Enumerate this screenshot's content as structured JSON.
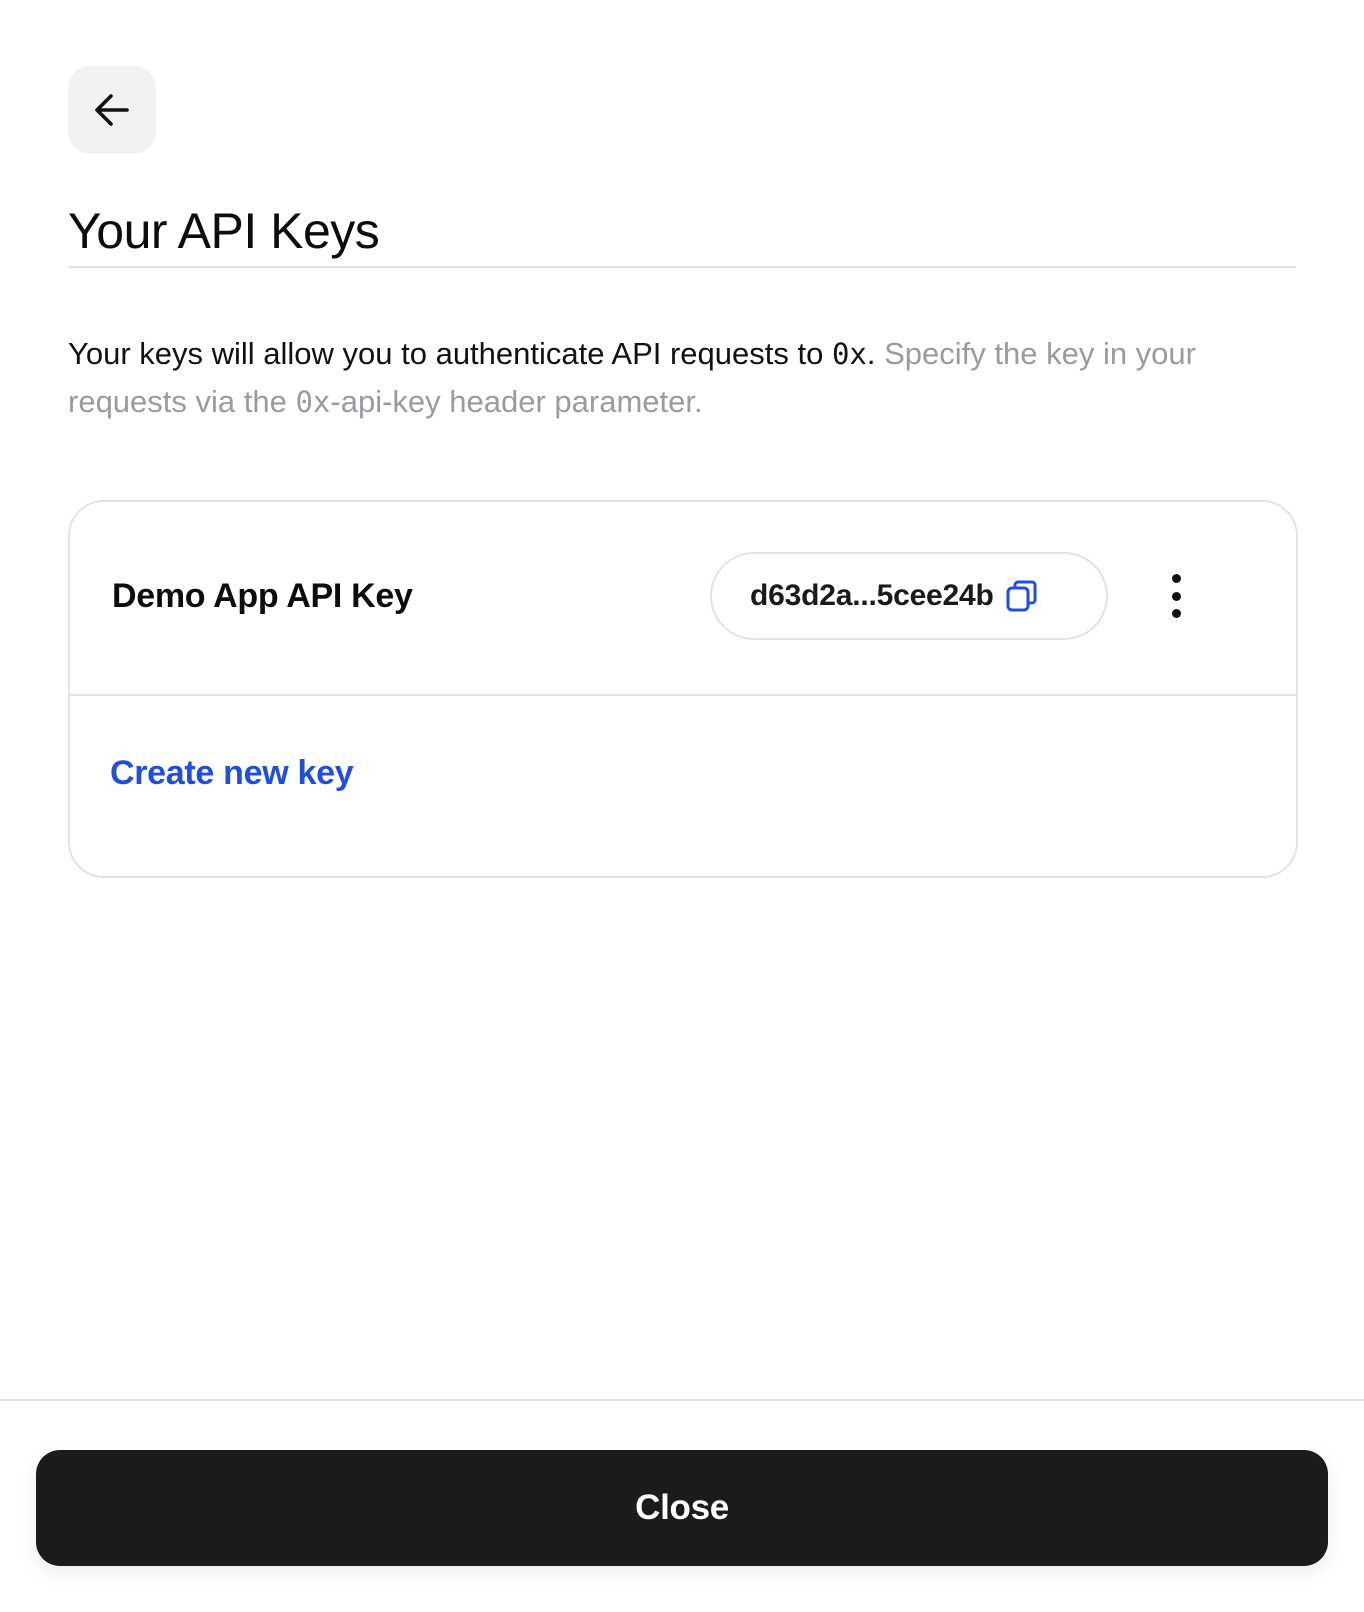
{
  "header": {
    "back_icon": "arrow-left-icon",
    "title": "Your API Keys"
  },
  "description": {
    "lead": "Your keys will allow you to authenticate API requests to ",
    "lead_code": "0x",
    "lead_end": ".",
    "muted_start": " Specify the key in your requests via the ",
    "muted_code": "0x",
    "muted_end": "-api-key header parameter."
  },
  "keys": [
    {
      "name": "Demo App API Key",
      "value": "d63d2a...5cee24b",
      "copy_icon": "copy-icon",
      "menu_icon": "more-vertical-icon"
    }
  ],
  "create_label": "Create new key",
  "footer": {
    "close_label": "Close"
  },
  "colors": {
    "accent": "#1f4fe0",
    "close_bg": "#1b1b1d",
    "muted_text": "#9a9aa0",
    "border": "#e4e4e7"
  }
}
